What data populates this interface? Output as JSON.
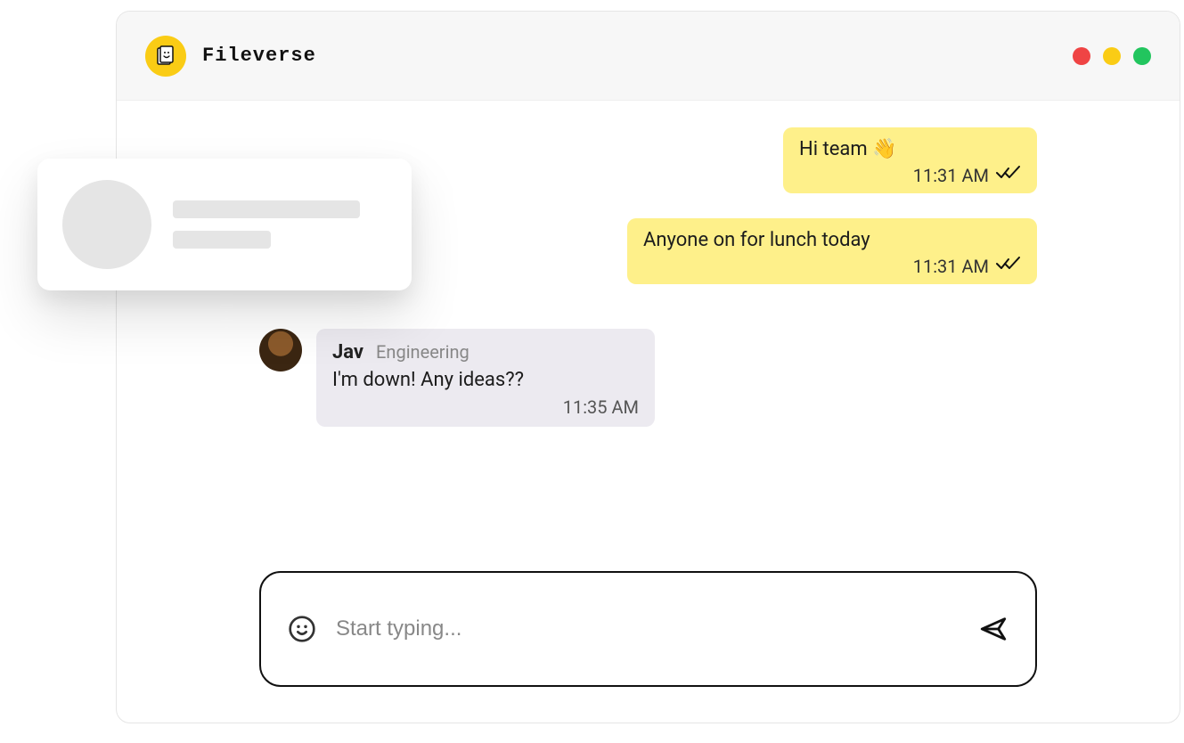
{
  "brand": {
    "name": "Fileverse"
  },
  "messages": {
    "sent": [
      {
        "text": "Hi team 👋",
        "time": "11:31 AM"
      },
      {
        "text": "Anyone on for lunch today",
        "time": "11:31 AM"
      }
    ],
    "received": [
      {
        "name": "Jav",
        "role": "Engineering",
        "text": "I'm down! Any ideas??",
        "time": "11:35 AM"
      }
    ]
  },
  "composer": {
    "placeholder": "Start typing..."
  },
  "colors": {
    "accent_yellow": "#facc15",
    "sent_bubble": "#fef08a",
    "recv_bubble": "#eceaf0"
  }
}
